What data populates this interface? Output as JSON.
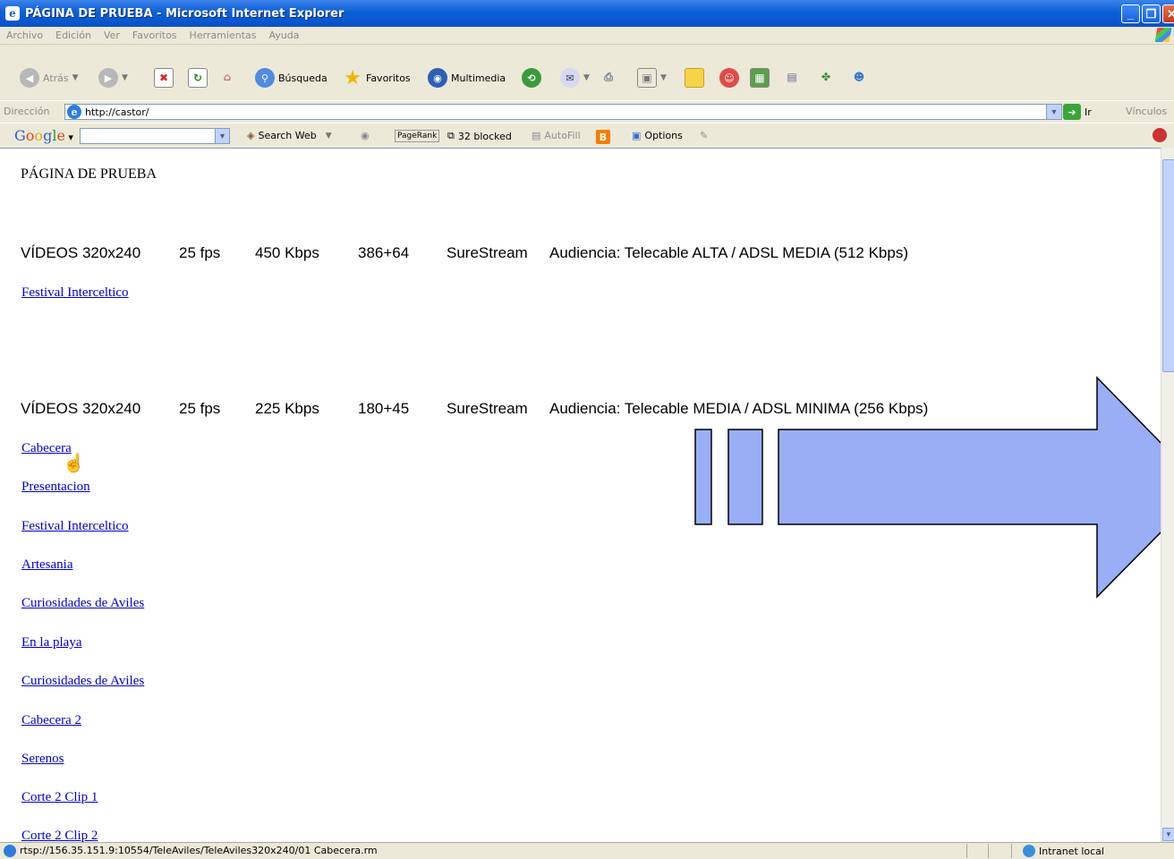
{
  "window": {
    "title": "PÁGINA DE PRUEBA - Microsoft Internet Explorer",
    "controls": [
      "minimize",
      "maximize",
      "close"
    ]
  },
  "menu": [
    "Archivo",
    "Edición",
    "Ver",
    "Favoritos",
    "Herramientas",
    "Ayuda"
  ],
  "toolbar": {
    "back": "Atrás",
    "search": "Búsqueda",
    "favorites": "Favoritos",
    "media": "Multimedia"
  },
  "address": {
    "label": "Dirección",
    "url": "http://castor/",
    "go": "Ir",
    "links": "Vínculos"
  },
  "google": {
    "logo": "Google",
    "search_web": "Search Web",
    "pagerank": "PageRank",
    "blocked": "32 blocked",
    "autofill": "AutoFill",
    "options": "Options"
  },
  "page": {
    "title": "PÁGINA DE PRUEBA",
    "section1": {
      "cols": [
        "VÍDEOS 320x240",
        "25 fps",
        "450 Kbps",
        "386+64",
        "SureStream",
        "Audiencia: Telecable ALTA / ADSL MEDIA (512 Kbps)"
      ],
      "links": [
        "Festival Interceltico"
      ]
    },
    "section2": {
      "cols": [
        "VÍDEOS 320x240",
        "25 fps",
        "225 Kbps",
        "180+45",
        "SureStream",
        "Audiencia: Telecable MEDIA / ADSL MINIMA (256 Kbps)"
      ],
      "links": [
        "Cabecera",
        "Presentacion",
        "Festival Interceltico",
        "Artesania",
        "Curiosidades de Aviles",
        "En la playa",
        "Curiosidades de Aviles",
        "Cabecera 2",
        "Serenos",
        "Corte 2 Clip 1",
        "Corte 2 Clip 2"
      ]
    }
  },
  "status": {
    "text": "rtsp://156.35.151.9:10554/TeleAviles/TeleAviles320x240/01 Cabecera.rm",
    "zone": "Intranet local"
  },
  "colors": {
    "arrow_fill": "#9aaef5",
    "link": "#0000cc",
    "titlebar": "#0a5fd8"
  }
}
